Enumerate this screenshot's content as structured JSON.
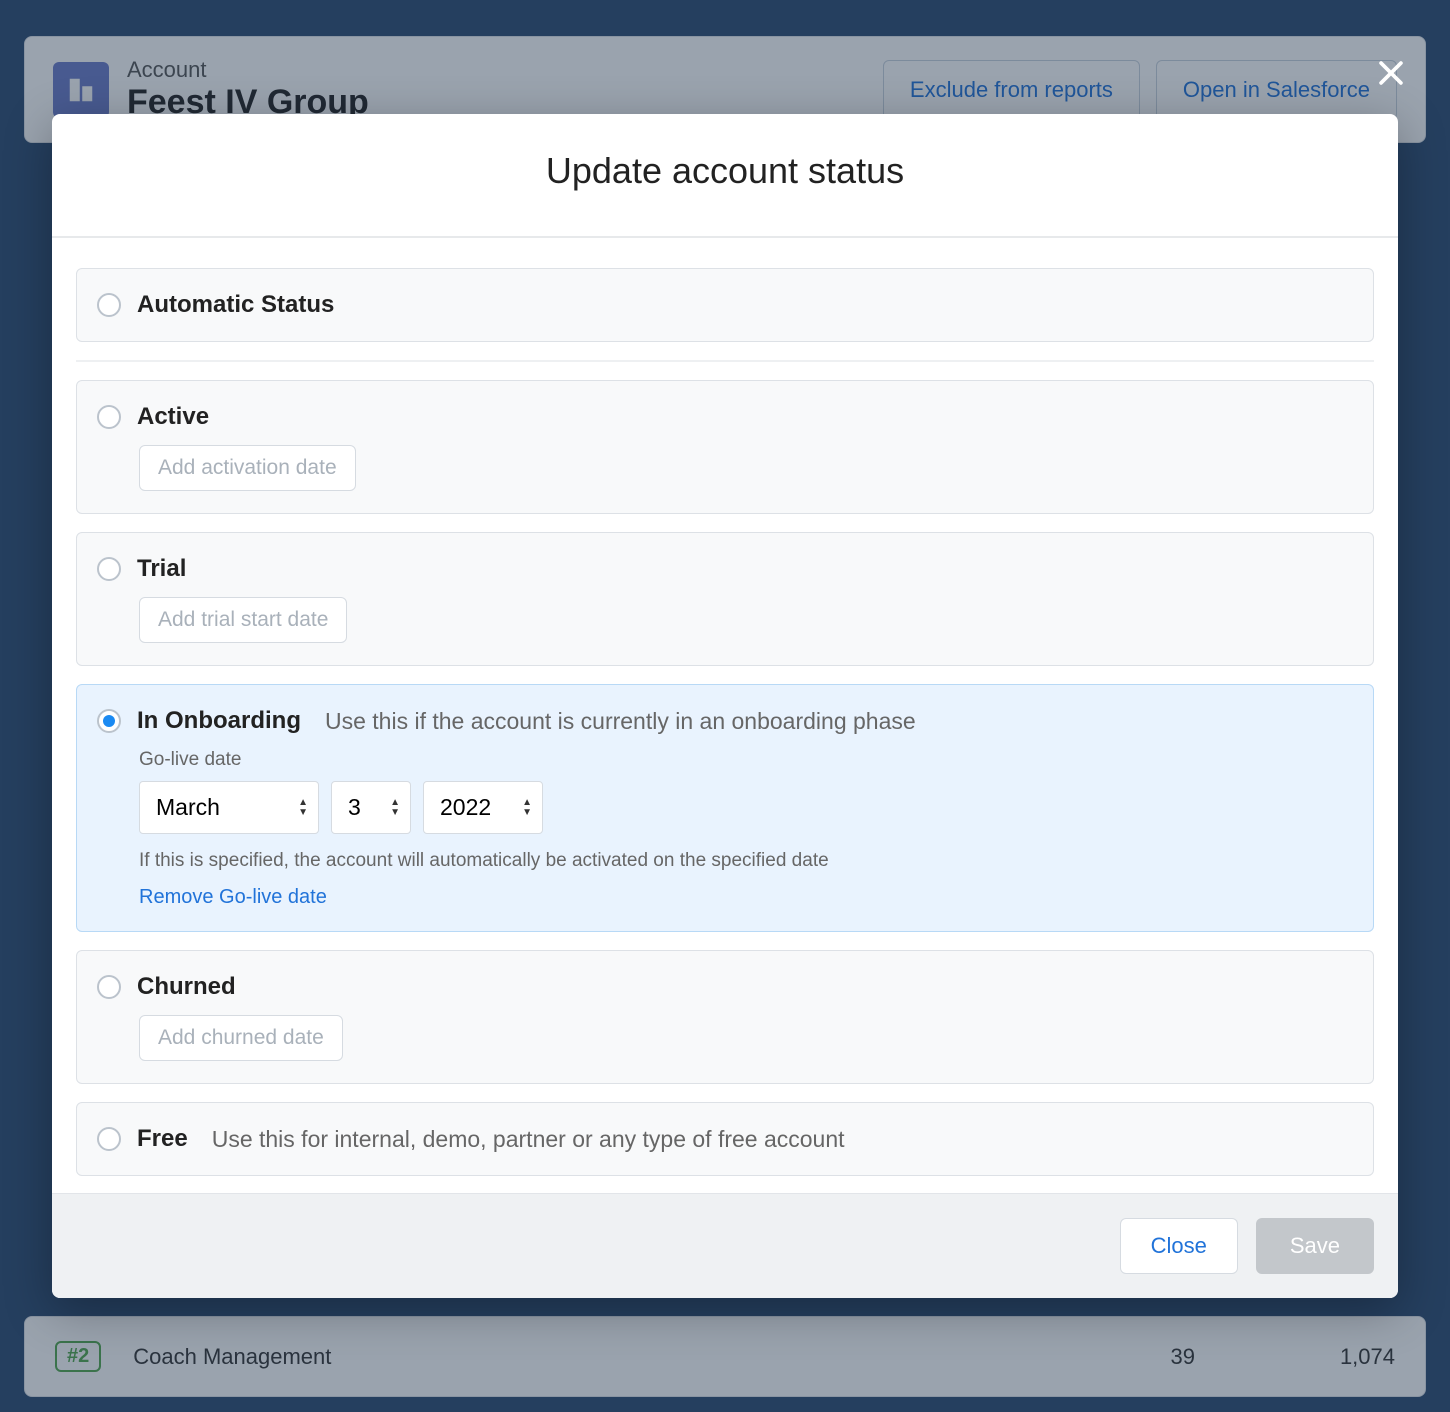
{
  "background": {
    "account_label": "Account",
    "account_name": "Feest IV Group",
    "exclude_label": "Exclude from reports",
    "open_sf_label": "Open in Salesforce",
    "row": {
      "rank": "#2",
      "name": "Coach Management",
      "value1": "39",
      "value2": "1,074"
    }
  },
  "modal": {
    "title": "Update account status",
    "options": {
      "automatic": {
        "label": "Automatic Status"
      },
      "active": {
        "label": "Active",
        "placeholder_btn": "Add activation date"
      },
      "trial": {
        "label": "Trial",
        "placeholder_btn": "Add trial start date"
      },
      "onboarding": {
        "label": "In Onboarding",
        "description": "Use this if the account is currently in an onboarding phase",
        "sub_label": "Go-live date",
        "month": "March",
        "day": "3",
        "year": "2022",
        "hint": "If this is specified, the account will automatically be activated on the specified date",
        "remove_link": "Remove Go-live date"
      },
      "churned": {
        "label": "Churned",
        "placeholder_btn": "Add churned date"
      },
      "free": {
        "label": "Free",
        "description": "Use this for internal, demo, partner or any type of free account"
      }
    },
    "footer": {
      "close": "Close",
      "save": "Save"
    }
  }
}
